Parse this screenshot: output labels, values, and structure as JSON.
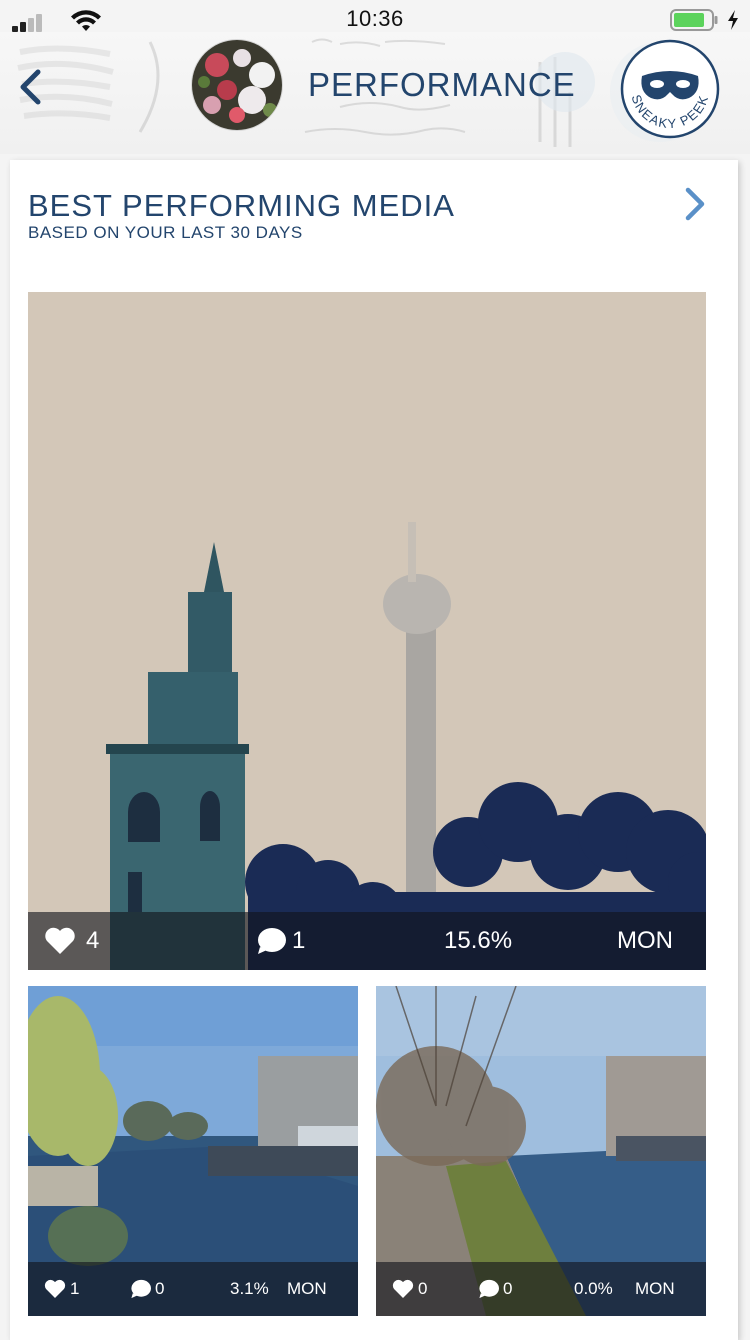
{
  "status_bar": {
    "time": "10:36"
  },
  "header": {
    "title": "PERFORMANCE",
    "badge_text": "SNEAKY PEEK",
    "back_icon": "chevron-left-icon",
    "avatar_icon": "profile-avatar"
  },
  "section": {
    "title": "BEST PERFORMING MEDIA",
    "subtitle": "BASED ON YOUR LAST 30 DAYS",
    "more_icon": "chevron-right-icon"
  },
  "media": [
    {
      "likes": "4",
      "comments": "1",
      "rate": "15.6%",
      "day": "MON"
    },
    {
      "likes": "1",
      "comments": "0",
      "rate": "3.1%",
      "day": "MON"
    },
    {
      "likes": "0",
      "comments": "0",
      "rate": "0.0%",
      "day": "MON"
    }
  ],
  "colors": {
    "accent": "#23456d",
    "chevron": "#5a90c8",
    "battery": "#5cd35c",
    "overlay": "#12141c"
  }
}
